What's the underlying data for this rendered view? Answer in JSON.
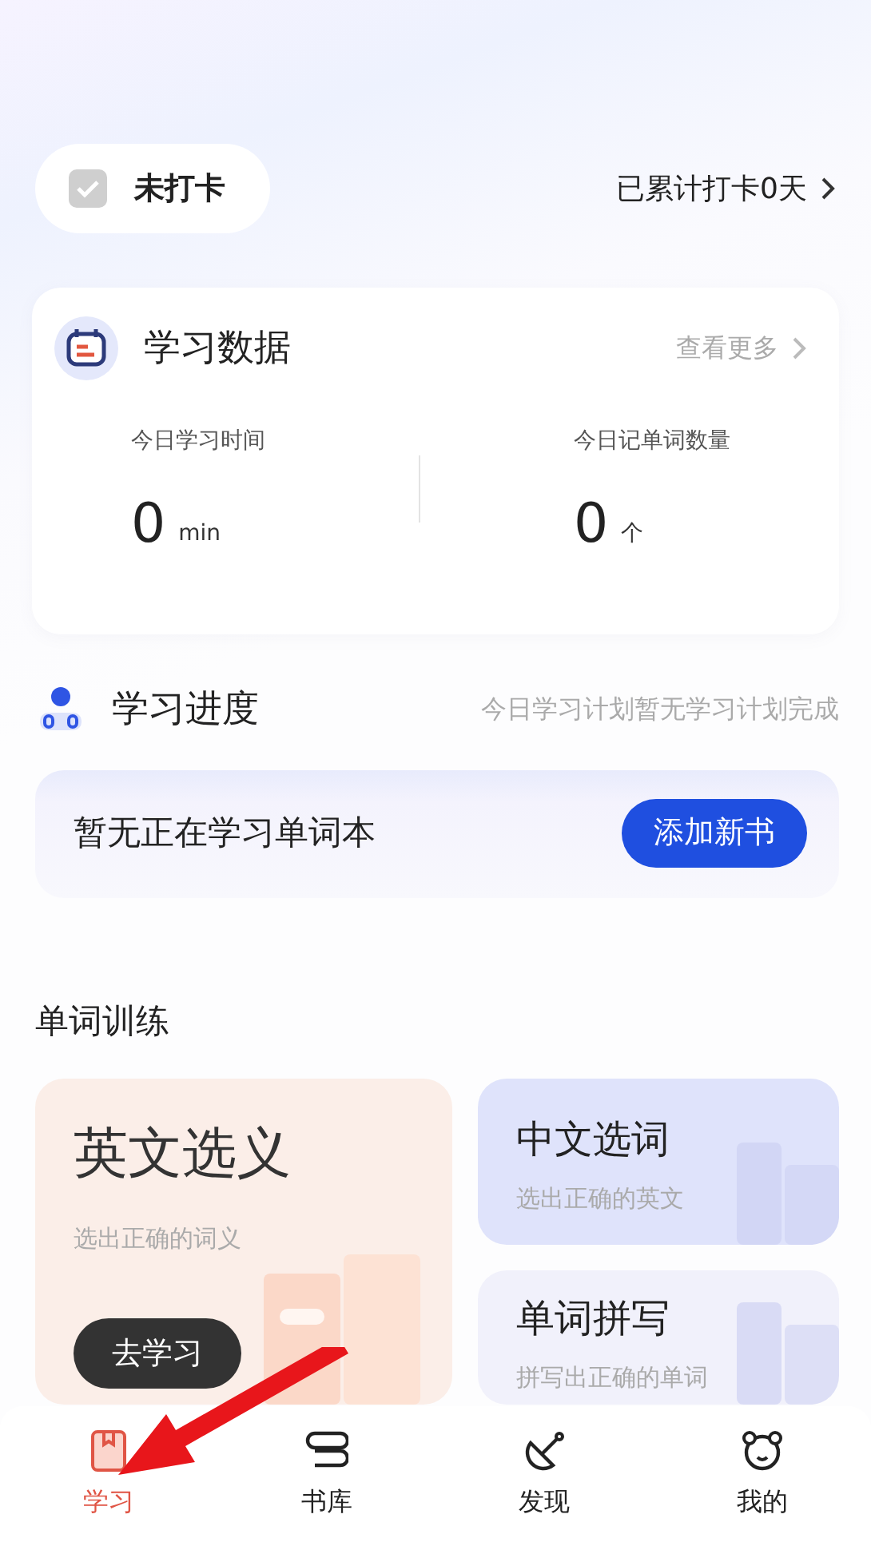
{
  "checkin": {
    "label": "未打卡",
    "checked": false
  },
  "streak": "已累计打卡0天",
  "stats_card": {
    "title": "学习数据",
    "more": "查看更多",
    "stats": [
      {
        "label": "今日学习时间",
        "value": "0",
        "unit": "min"
      },
      {
        "label": "今日记单词数量",
        "value": "0",
        "unit": "个"
      }
    ]
  },
  "progress": {
    "title": "学习进度",
    "note": "今日学习计划暂无学习计划完成",
    "empty_text": "暂无正在学习单词本",
    "button": "添加新书"
  },
  "training": {
    "title": "单词训练",
    "cards": [
      {
        "kind": "large",
        "title": "英文选义",
        "subtitle": "选出正确的词义",
        "button": "去学习",
        "color": "#fbeee8"
      },
      {
        "kind": "small",
        "title": "中文选词",
        "subtitle": "选出正确的英文",
        "color": "#dfe3fb"
      },
      {
        "kind": "small",
        "title": "单词拼写",
        "subtitle": "拼写出正确的单词",
        "color": "#f1f1fb"
      }
    ]
  },
  "tabs": [
    {
      "label": "学习",
      "selected": true
    },
    {
      "label": "书库",
      "selected": false
    },
    {
      "label": "发现",
      "selected": false
    },
    {
      "label": "我的",
      "selected": false
    }
  ]
}
